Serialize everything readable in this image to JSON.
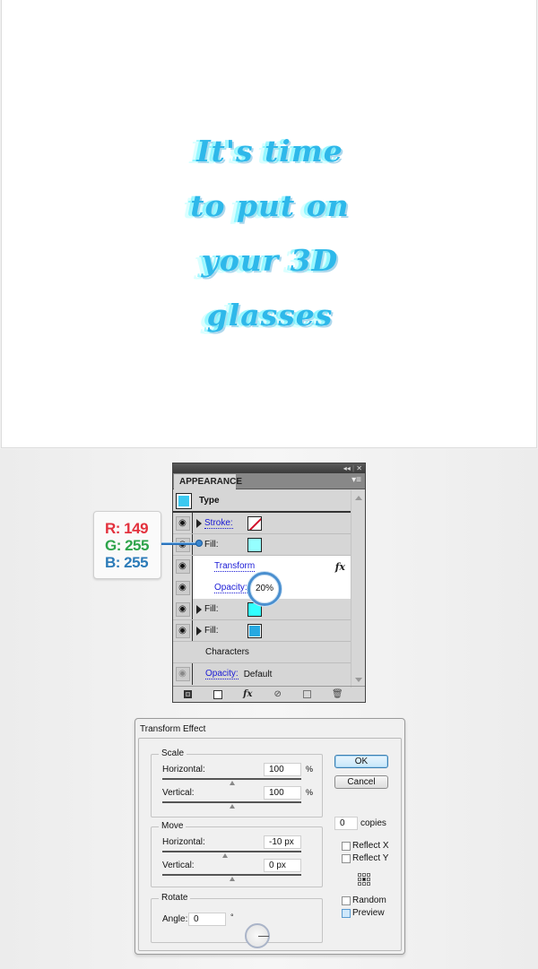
{
  "artwork": {
    "lines": [
      "It's time",
      "to put on",
      "your 3D",
      "glasses"
    ],
    "text_color": "#2eb8ea"
  },
  "rgb_callout": {
    "r": "R: 149",
    "g": "G: 255",
    "b": "B: 255"
  },
  "appearance_panel": {
    "title": "APPEARANCE",
    "titlebar_collapse": "◂◂",
    "titlebar_close": "✕",
    "menu_icon": "▾≡",
    "object_type": "Type",
    "rows": [
      {
        "kind": "stroke",
        "label": "Stroke:",
        "swatch": "none"
      },
      {
        "kind": "fill",
        "label": "Fill:",
        "swatch_color": "#95ffff"
      },
      {
        "kind": "effect",
        "label": "Transform",
        "fx": "fx"
      },
      {
        "kind": "opacity",
        "label": "Opacity:",
        "value": "20%"
      },
      {
        "kind": "fill",
        "label": "Fill:",
        "swatch_color": "#33ffff"
      },
      {
        "kind": "fill",
        "label": "Fill:",
        "swatch_color": "#27a9e1"
      },
      {
        "kind": "characters",
        "label": "Characters"
      },
      {
        "kind": "opacity",
        "label": "Opacity:",
        "value": "Default"
      }
    ],
    "footer_fx": "fx"
  },
  "transform_dialog": {
    "title": "Transform Effect",
    "scale": {
      "label": "Scale",
      "horizontal_label": "Horizontal:",
      "horizontal_value": "100",
      "vertical_label": "Vertical:",
      "vertical_value": "100",
      "unit": "%"
    },
    "move": {
      "label": "Move",
      "horizontal_label": "Horizontal:",
      "horizontal_value": "-10 px",
      "vertical_label": "Vertical:",
      "vertical_value": "0 px"
    },
    "rotate": {
      "label": "Rotate",
      "angle_label": "Angle:",
      "angle_value": "0",
      "unit": "°"
    },
    "ok_label": "OK",
    "cancel_label": "Cancel",
    "copies_value": "0",
    "copies_label": "copies",
    "reflect_x_label": "Reflect X",
    "reflect_y_label": "Reflect Y",
    "random_label": "Random",
    "preview_label": "Preview"
  }
}
